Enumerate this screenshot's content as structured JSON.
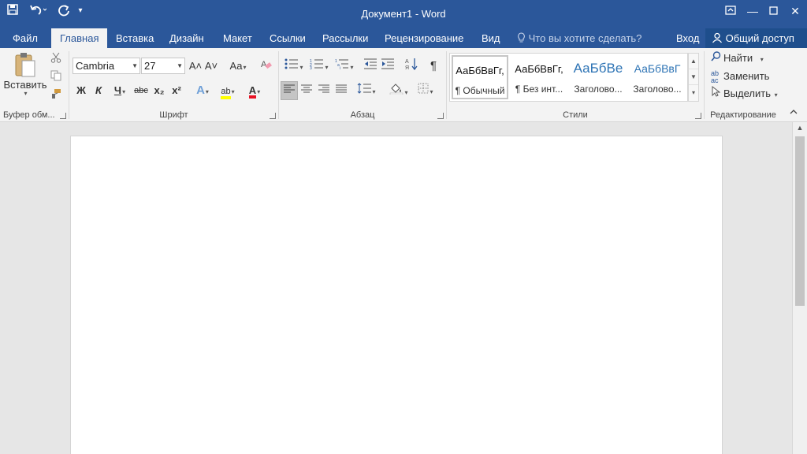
{
  "titlebar": {
    "title": "Документ1 - Word",
    "qat": {
      "save_icon": "save-icon",
      "undo_icon": "undo-icon",
      "redo_icon": "redo-icon",
      "customize_icon": "customize-qat-icon"
    },
    "window_buttons": [
      "ribbon-display-options-icon",
      "minimize-icon",
      "maximize-icon",
      "close-icon"
    ]
  },
  "tabs": [
    {
      "label": "Файл",
      "active": false
    },
    {
      "label": "Главная",
      "active": true
    },
    {
      "label": "Вставка",
      "active": false
    },
    {
      "label": "Дизайн",
      "active": false
    },
    {
      "label": "Макет",
      "active": false
    },
    {
      "label": "Ссылки",
      "active": false
    },
    {
      "label": "Рассылки",
      "active": false
    },
    {
      "label": "Рецензирование",
      "active": false
    },
    {
      "label": "Вид",
      "active": false
    }
  ],
  "tellme": {
    "placeholder": "Что вы хотите сделать?"
  },
  "signin": {
    "label": "Вход"
  },
  "share": {
    "label": "Общий доступ"
  },
  "ribbon": {
    "clipboard": {
      "label": "Буфер обм...",
      "paste_label": "Вставить"
    },
    "font": {
      "label": "Шрифт",
      "font_name": "Cambria",
      "font_size": "27",
      "bold": "Ж",
      "italic": "К",
      "underline": "Ч",
      "strike": "abc",
      "subscript": "x₂",
      "superscript": "x²",
      "grow": "A˄",
      "shrink": "A˅",
      "change_case": "Aa",
      "font_color_letter": "A",
      "highlight_letter": "ab"
    },
    "paragraph": {
      "label": "Абзац",
      "pilcrow": "¶"
    },
    "styles": {
      "label": "Стили",
      "items": [
        {
          "preview": "АаБбВвГг,",
          "name": "¶ Обычный"
        },
        {
          "preview": "АаБбВвГг,",
          "name": "¶ Без инт..."
        },
        {
          "preview": "АаБбВе",
          "name": "Заголово..."
        },
        {
          "preview": "АаБбВвГ",
          "name": "Заголово..."
        }
      ]
    },
    "editing": {
      "label": "Редактирование",
      "find": "Найти",
      "replace": "Заменить",
      "select": "Выделить"
    }
  },
  "colors": {
    "accent": "#2b579a",
    "font_color": "#e81123",
    "highlight": "#ffff00",
    "heading": "#2e74b5"
  }
}
